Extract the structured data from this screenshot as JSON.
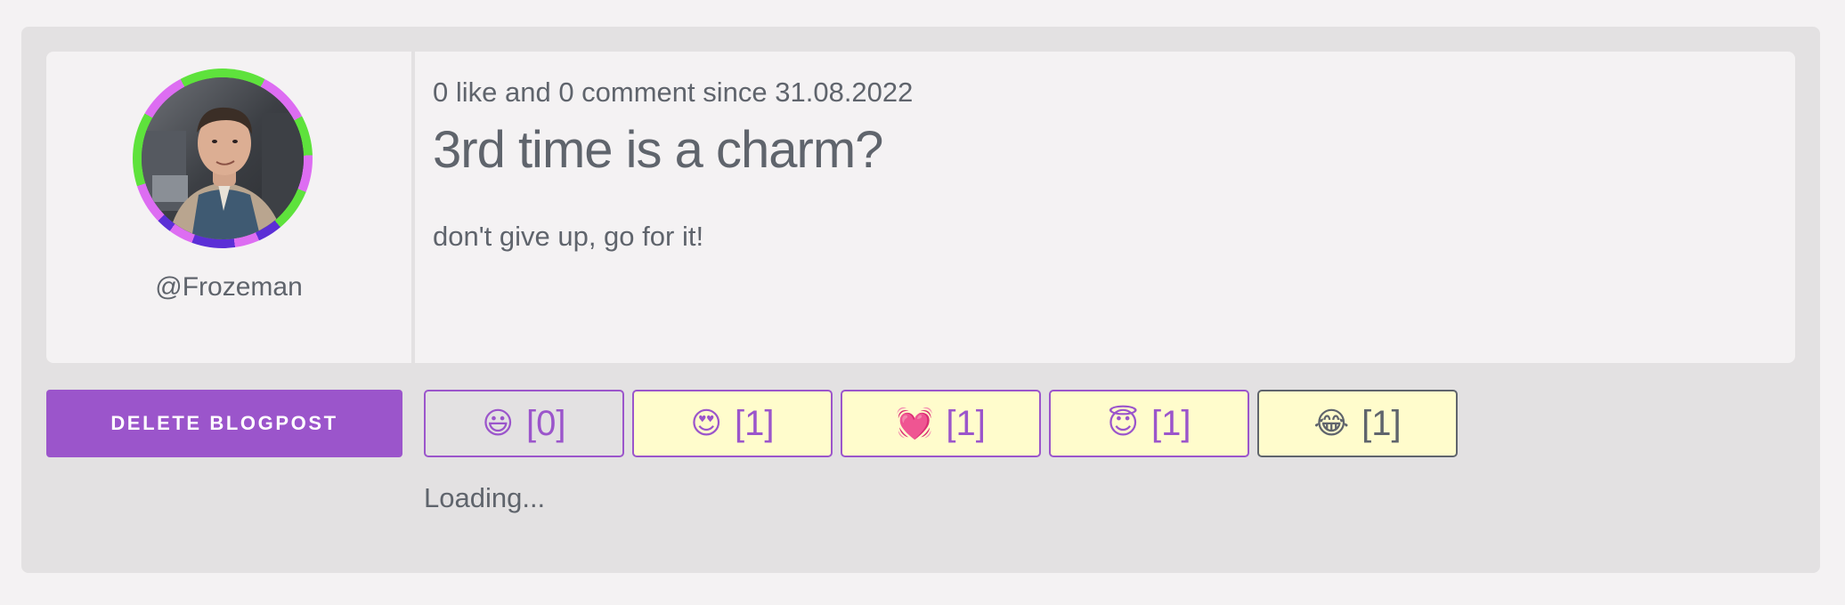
{
  "author": {
    "handle": "@Frozeman",
    "avatar_icon": "user-avatar-photo"
  },
  "post": {
    "meta": "0 like and 0 comment since 31.08.2022",
    "title": "3rd time is a charm?",
    "body": "don't give up, go for it!"
  },
  "actions": {
    "delete_label": "Delete Blogpost"
  },
  "reactions": [
    {
      "emoji": "😃",
      "count": "[0]",
      "state": "inactive"
    },
    {
      "emoji": "😍",
      "count": "[1]",
      "state": "active"
    },
    {
      "emoji": "💓",
      "count": "[1]",
      "state": "active"
    },
    {
      "emoji": "😇",
      "count": "[1]",
      "state": "active"
    },
    {
      "emoji": "😂",
      "count": "[1]",
      "state": "own"
    }
  ],
  "status": {
    "loading_text": "Loading..."
  },
  "colors": {
    "accent": "#9b55cb",
    "reaction_bg": "#fffccc",
    "panel_bg": "#e3e1e2",
    "text": "#5f646c"
  }
}
